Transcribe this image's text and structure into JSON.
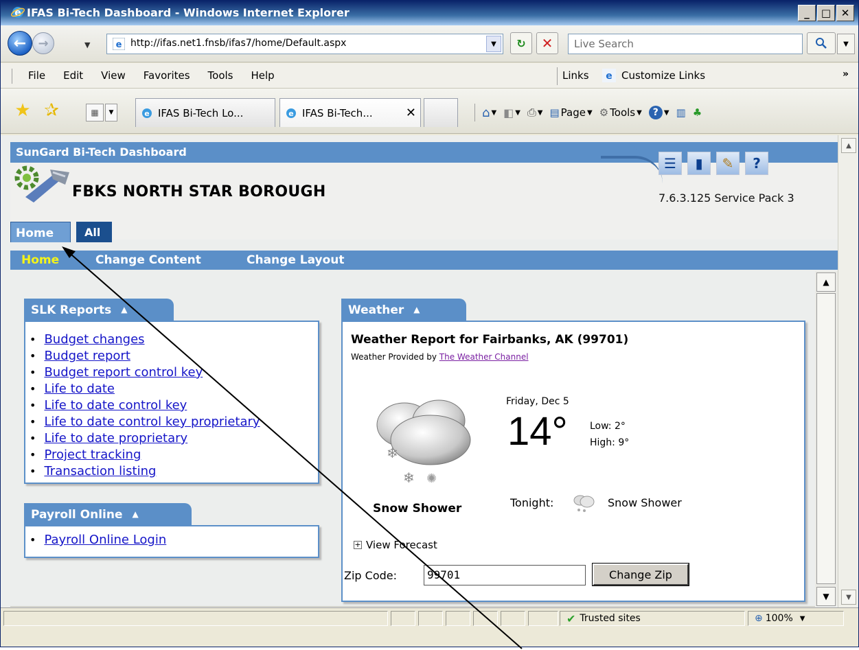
{
  "window": {
    "title": "IFAS Bi-Tech Dashboard - Windows Internet Explorer",
    "min_label": "_",
    "max_label": "□",
    "close_label": "✕"
  },
  "address_bar": {
    "url": "http://ifas.net1.fnsb/ifas7/home/Default.aspx",
    "search_placeholder": "Live Search"
  },
  "menu": {
    "items": [
      "File",
      "Edit",
      "View",
      "Favorites",
      "Tools",
      "Help"
    ],
    "links_label": "Links",
    "customize_links": "Customize Links"
  },
  "tabs": {
    "items": [
      {
        "label": "IFAS Bi-Tech Lo..."
      },
      {
        "label": "IFAS Bi-Tech..."
      }
    ],
    "command": {
      "page": "Page",
      "tools": "Tools"
    }
  },
  "dashboard": {
    "brand": "SunGard Bi-Tech Dashboard",
    "org_name": "FBKS NORTH STAR BOROUGH",
    "version": "7.6.3.125 Service Pack 3",
    "tabs": [
      "Home",
      "All"
    ],
    "subnav": [
      "Home",
      "Change Content",
      "Change Layout"
    ]
  },
  "slk_reports": {
    "title": "SLK Reports",
    "links": [
      "Budget changes",
      "Budget report",
      "Budget report control key",
      "Life to date",
      "Life to date control key",
      "Life to date control key proprietary",
      "Life to date proprietary",
      "Project tracking",
      "Transaction listing"
    ]
  },
  "payroll_online": {
    "title": "Payroll Online",
    "links": [
      "Payroll Online Login"
    ]
  },
  "weather": {
    "tab_title": "Weather",
    "report_title": "Weather Report for Fairbanks, AK (99701)",
    "provided_by": "Weather Provided by",
    "provider": "The Weather Channel",
    "date": "Friday, Dec 5",
    "temperature": "14°",
    "low": "Low: 2°",
    "high": "High: 9°",
    "condition": "Snow Shower",
    "tonight_label": "Tonight:",
    "tonight_condition": "Snow Shower",
    "view_forecast": "View Forecast",
    "zip_label": "Zip Code:",
    "zip_value": "99701",
    "change_zip": "Change Zip"
  },
  "status_bar": {
    "zone": "Trusted sites",
    "zoom": "100%"
  },
  "colors": {
    "dashboard_blue": "#5b8fc8",
    "active_subnav": "#f4f418",
    "link": "#1515c8"
  }
}
